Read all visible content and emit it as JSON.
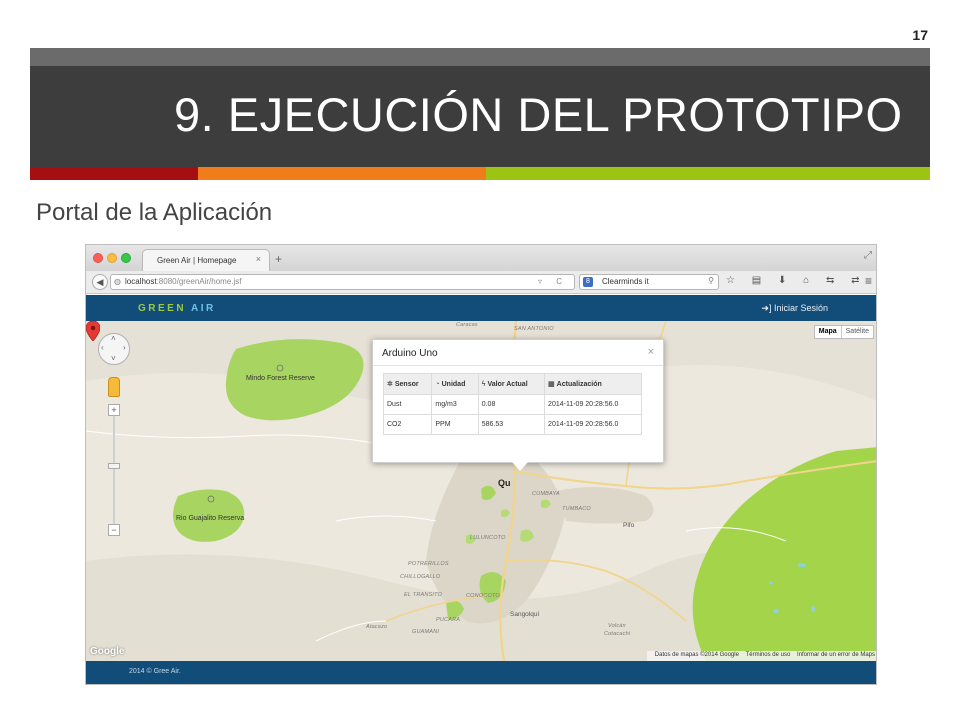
{
  "slide": {
    "page_number": "17",
    "title": "9. EJECUCIÓN DEL PROTOTIPO",
    "subtitle": "Portal de la Aplicación",
    "colors": {
      "title_band": "#3d3d3d",
      "stripe_red": "#a50f12",
      "stripe_orange": "#f07d1a",
      "stripe_green": "#9cc414"
    }
  },
  "browser": {
    "tab_title": "Green Air | Homepage",
    "tab_close": "×",
    "new_tab": "+",
    "fullscreen_icon": "⤢",
    "url_host": "localhost",
    "url_path": ":8080/greenAir/home.jsf",
    "url_tools": "▿ C",
    "search_placeholder": "Clearminds it",
    "search_engine_icon": "8",
    "toolbar_icons": [
      "star-icon",
      "bookmarks-icon",
      "download-icon",
      "home-icon",
      "sync-icon",
      "extension-icon"
    ],
    "toolbar_glyphs": "☆ ▤ ⬇ ⌂ ⇆ ⇄ ▾",
    "menu_icon": "≡"
  },
  "app": {
    "brand_part1": "GREEN",
    "brand_part2": "AIR",
    "login_link": "➜] Iniciar Sesión",
    "footer": "2014 © Gree Air.",
    "colors": {
      "header": "#124d7a",
      "brand_green": "#9acb3c",
      "brand_blue": "#6ec1ea"
    }
  },
  "map": {
    "type_active": "Mapa",
    "type_inactive": "Satélite",
    "zoom_in": "+",
    "zoom_out": "−",
    "google_logo": "Google",
    "attribution": [
      "Datos de mapas ©2014 Google",
      "Términos de uso",
      "Informar de un error de Maps"
    ],
    "labels": {
      "caracas": "Caracas",
      "san_antonio": "SAN ANTONIO",
      "mindo": "Mindo Forest Reserve",
      "rio_guajalito": "Rio Guajalito Reserva",
      "quito": "Qu",
      "cumbaya": "CUMBAYA",
      "tumbaco": "TUMBACO",
      "pifo": "Pifo",
      "lulumcoto": "LULUNCOTO",
      "potrerillos": "POTRERILLOS",
      "chillogallo": "CHILLOGALLO",
      "el_transito": "EL TRANSITO",
      "conocoto": "CONOCOTO",
      "pucara": "PUCARA",
      "sangolqui": "Sangolquí",
      "atacazo": "Atacazo",
      "guamani": "GUAMANI",
      "volcan": "Volcán",
      "cotacachi": "Cotacachi"
    },
    "colors": {
      "land": "#ece8de",
      "park": "#a4d44a",
      "reserve": "#9bc86a",
      "water": "#8fcfe6"
    }
  },
  "infowindow": {
    "title": "Arduino Uno",
    "close": "×",
    "columns": [
      "Sensor",
      "Unidad",
      "Valor Actual",
      "Actualización"
    ],
    "column_icons": [
      "gear-icon",
      "gauge-icon",
      "bolt-icon",
      "calendar-icon"
    ],
    "column_glyphs": [
      "✲",
      "◔",
      "ϟ",
      "▦"
    ],
    "rows": [
      {
        "sensor": "Dust",
        "unidad": "mg/m3",
        "valor": "0.08",
        "actualizacion": "2014-11-09 20:28:56.0"
      },
      {
        "sensor": "CO2",
        "unidad": "PPM",
        "valor": "586.53",
        "actualizacion": "2014-11-09 20:28:56.0"
      }
    ]
  }
}
